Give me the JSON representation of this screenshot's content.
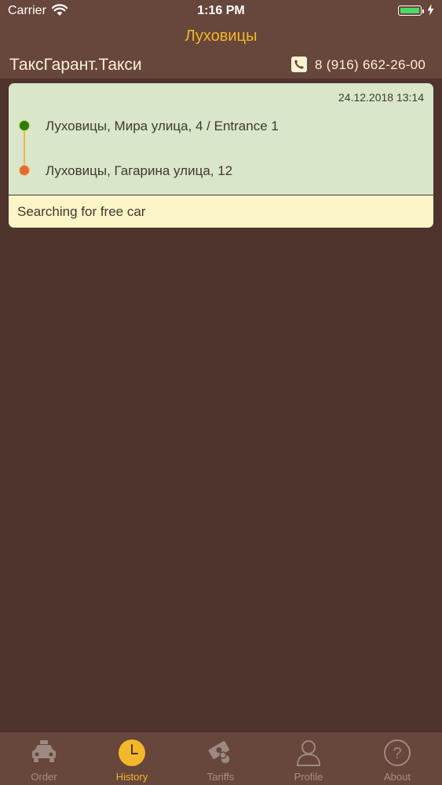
{
  "status_bar": {
    "carrier": "Carrier",
    "time": "1:16 PM"
  },
  "header": {
    "city": "Луховицы",
    "company": "ТаксГарант.Такси",
    "phone": "8 (916) 662-26-00"
  },
  "order": {
    "date": "24.12.2018 13:14",
    "from": "Луховицы, Мира улица, 4 / Entrance 1",
    "to": "Луховицы, Гагарина улица, 12",
    "status": "Searching for free car"
  },
  "tabs": [
    {
      "label": "Order",
      "icon": "taxi-icon"
    },
    {
      "label": "History",
      "icon": "clock-icon"
    },
    {
      "label": "Tariffs",
      "icon": "tariffs-icon"
    },
    {
      "label": "Profile",
      "icon": "person-icon"
    },
    {
      "label": "About",
      "icon": "question-icon"
    }
  ],
  "active_tab": "History",
  "colors": {
    "accent": "#f3b72b",
    "background": "#4f332d",
    "bar": "#67463b",
    "card": "#d9e6c9",
    "status_bg": "#fbf5c7",
    "start_dot": "#2f7a08",
    "end_dot": "#e36a37"
  }
}
